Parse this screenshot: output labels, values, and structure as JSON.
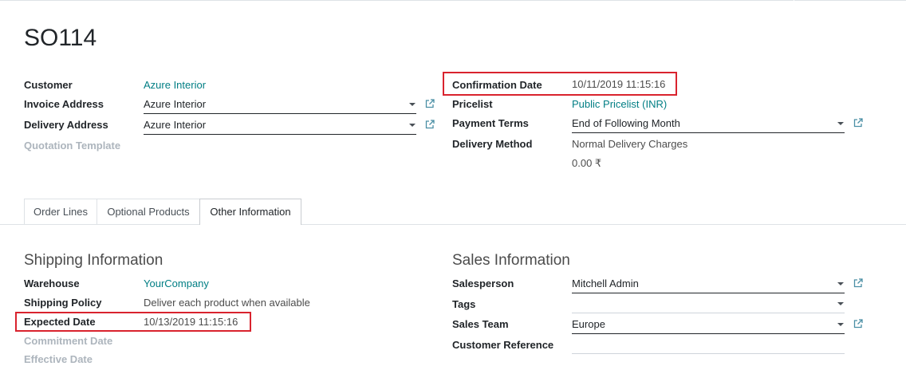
{
  "record": {
    "title": "SO114"
  },
  "left_fields": {
    "customer": {
      "label": "Customer",
      "value": "Azure Interior"
    },
    "invoice_address": {
      "label": "Invoice Address",
      "value": "Azure Interior"
    },
    "delivery_address": {
      "label": "Delivery Address",
      "value": "Azure Interior"
    },
    "quotation_template": {
      "label": "Quotation Template"
    }
  },
  "right_fields": {
    "confirmation_date": {
      "label": "Confirmation Date",
      "value": "10/11/2019 11:15:16"
    },
    "pricelist": {
      "label": "Pricelist",
      "value": "Public Pricelist (INR)"
    },
    "payment_terms": {
      "label": "Payment Terms",
      "value": "End of Following Month"
    },
    "delivery_method": {
      "label": "Delivery Method",
      "value": "Normal Delivery Charges",
      "amount": "0.00 ₹"
    }
  },
  "tabs": [
    {
      "label": "Order Lines"
    },
    {
      "label": "Optional Products"
    },
    {
      "label": "Other Information",
      "active": true
    }
  ],
  "shipping": {
    "title": "Shipping Information",
    "warehouse": {
      "label": "Warehouse",
      "value": "YourCompany"
    },
    "shipping_policy": {
      "label": "Shipping Policy",
      "value": "Deliver each product when available"
    },
    "expected_date": {
      "label": "Expected Date",
      "value": "10/13/2019 11:15:16"
    },
    "commitment_date": {
      "label": "Commitment Date"
    },
    "effective_date": {
      "label": "Effective Date"
    }
  },
  "sales": {
    "title": "Sales Information",
    "salesperson": {
      "label": "Salesperson",
      "value": "Mitchell Admin"
    },
    "tags": {
      "label": "Tags",
      "value": ""
    },
    "sales_team": {
      "label": "Sales Team",
      "value": "Europe"
    },
    "customer_reference": {
      "label": "Customer Reference",
      "value": ""
    }
  },
  "colors": {
    "link": "#017e84",
    "highlight": "#d9232e",
    "muted": "#adb5bd"
  },
  "icons": {
    "dropdown": "caret-down-icon",
    "external": "external-link-icon"
  }
}
